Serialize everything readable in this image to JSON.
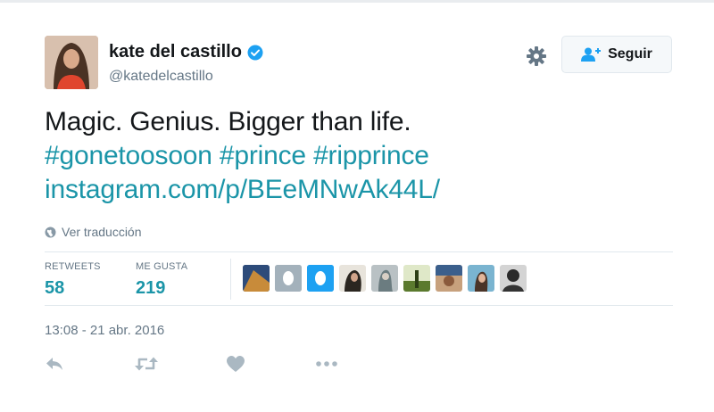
{
  "user": {
    "name": "kate del castillo",
    "handle": "@katedelcastillo",
    "verified_icon": "verified-badge-icon"
  },
  "header": {
    "follow_label": "Seguir",
    "follow_icon": "add-user-icon",
    "settings_icon": "gear-icon"
  },
  "tweet": {
    "text_line1": "Magic. Genius. Bigger than life.",
    "hashtag1": "#gonetoosoon",
    "hashtag2": "#prince",
    "hashtag3": "#ripprince",
    "link": "instagram.com/p/BEeMNwAk44L/"
  },
  "translate": {
    "label": "Ver traducción",
    "icon": "globe-icon"
  },
  "stats": {
    "retweets_label": "RETWEETS",
    "retweets_value": "58",
    "likes_label": "ME GUSTA",
    "likes_value": "219"
  },
  "timestamp": "13:08 - 21 abr. 2016",
  "actions": [
    "reply-icon",
    "retweet-icon",
    "like-icon",
    "more-icon"
  ],
  "colors": {
    "link": "#1b95a8",
    "text": "#14171a",
    "muted": "#657786",
    "verified": "#1da1f2"
  }
}
